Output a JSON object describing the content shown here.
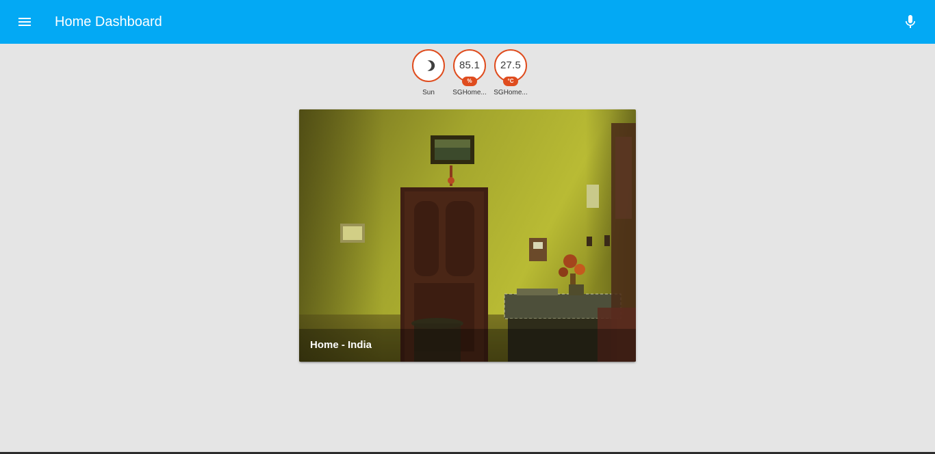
{
  "app": {
    "title": "Home Dashboard",
    "accent_color": "#03a9f4",
    "badge_color": "#df4c1e"
  },
  "toolbar": {
    "menu_icon": "menu-icon",
    "mic_icon": "microphone-icon"
  },
  "badges": [
    {
      "label": "Sun",
      "icon": "moon-icon",
      "value": "",
      "unit": ""
    },
    {
      "label": "SGHome...",
      "icon": "",
      "value": "85.1",
      "unit": "%"
    },
    {
      "label": "SGHome...",
      "icon": "",
      "value": "27.5",
      "unit": "°C"
    }
  ],
  "camera": {
    "caption": "Home - India"
  }
}
